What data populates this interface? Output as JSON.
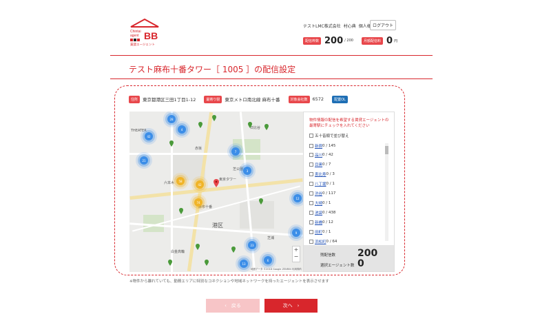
{
  "header": {
    "logo_text_top": "Chintai agent",
    "logo_text_bb": "BB",
    "logo_text_bottom": "賃貸エージェント",
    "company": "テストLMC株式会社",
    "user_name": "村心典",
    "user_honorific": "個人様",
    "logout_label": "ログアウト",
    "delivery_count_label": "配信枠数",
    "delivery_count_value": "200",
    "delivery_count_unit": "/ 200",
    "monthly_fee_label": "月額配信料",
    "monthly_fee_value": "0",
    "monthly_fee_unit": "円"
  },
  "page": {
    "title": "テスト麻布十番タワー［ 1005 ］の配信設定"
  },
  "property": {
    "address_label": "住所",
    "address_value": "東京都港区三田1丁目1-12",
    "station_label": "最寄り駅",
    "station_value": "東京メトロ南北線 麻布十番",
    "agents_label": "対象会社数",
    "agents_value": "6572",
    "status_label": "配置OL"
  },
  "map": {
    "labels": [
      "THEATER",
      "六本木",
      "港区",
      "芝公園",
      "東京タワー",
      "麻布十番",
      "白金高輪",
      "芝浦",
      "日比谷",
      "赤坂"
    ],
    "clusters": [
      "28",
      "4",
      "42",
      "21",
      "7",
      "3",
      "58",
      "42",
      "74",
      "12",
      "9",
      "23",
      "6",
      "13"
    ],
    "zoom_in": "+",
    "zoom_out": "−",
    "attribution": "地図データ ©2018 Google ZENRIN 利用規約"
  },
  "agent_list": {
    "note": "物件情報の配信を希望する賃貸エージェントの最寄駅にチェックを入れてください",
    "check_all_label": "五十音順で並び替え",
    "items": [
      {
        "name": "新宿",
        "count": "0 / 145"
      },
      {
        "name": "品川",
        "count": "0 / 42"
      },
      {
        "name": "目黒",
        "count": "0 / 7"
      },
      {
        "name": "恵比寿",
        "count": "0 / 3"
      },
      {
        "name": "八丁堀",
        "count": "0 / 1"
      },
      {
        "name": "渋谷",
        "count": "0 / 117"
      },
      {
        "name": "大崎",
        "count": "0 / 1"
      },
      {
        "name": "池袋",
        "count": "0 / 438"
      },
      {
        "name": "新橋",
        "count": "0 / 12"
      },
      {
        "name": "田町",
        "count": "0 / 1"
      },
      {
        "name": "浜松町",
        "count": "0 / 64"
      }
    ],
    "total_label": "残配信数",
    "total_value": "200",
    "selected_label": "選択エージェント数",
    "selected_value": "0"
  },
  "footnote": "※物件から離れていても、勤務エリアに特別なコネクションや地域ネットワークを持ったエージェントを表示させます",
  "buttons": {
    "back": "‹　戻る",
    "next": "次へ　›"
  }
}
